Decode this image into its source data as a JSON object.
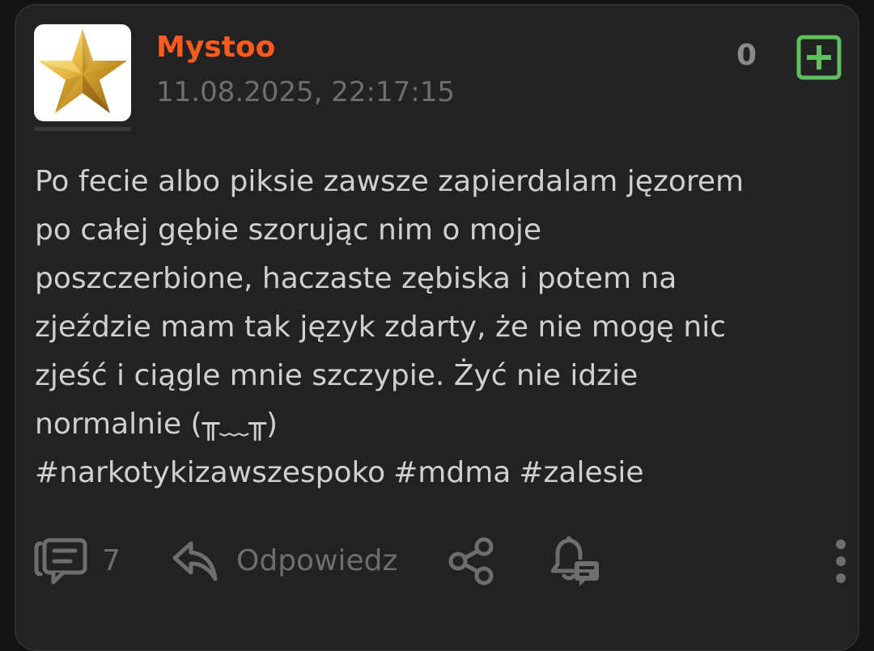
{
  "post": {
    "author": "Mystoo",
    "timestamp": "11.08.2025, 22:17:15",
    "vote_count": "0",
    "body": "Po fecie albo piksie zawsze zapierdalam jęzorem\npo całej gębie szorując nim o moje\nposzczerbione, haczaste zębiska i potem na\nzjeździe mam tak język zdarty, że nie mogę nic\nzjeść i ciągle mnie szczypie. Żyć nie idzie\nnormalnie (╥﹏╥)",
    "hashtags": [
      "#narkotykizawszespoko",
      "#mdma",
      "#zalesie"
    ]
  },
  "actions": {
    "comment_count": "7",
    "reply_label": "Odpowiedz"
  },
  "icons": {
    "avatar": "gold-star-icon",
    "plus": "plus-box-icon",
    "comments": "comments-icon",
    "reply": "reply-arrow-icon",
    "share": "share-icon",
    "notify": "bell-comment-icon",
    "more": "more-vertical-icon"
  },
  "colors": {
    "card_bg": "#222222",
    "author": "#ff5a1f",
    "plus_green": "#5fbf5f",
    "muted": "#6e6e6e",
    "text": "#d0d0d0"
  }
}
